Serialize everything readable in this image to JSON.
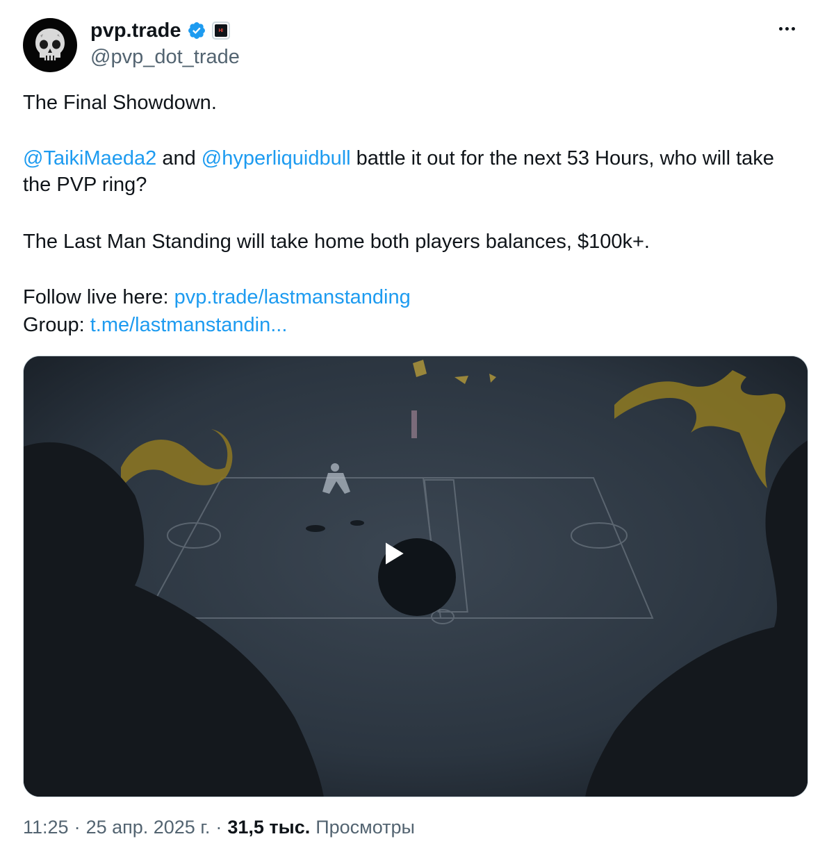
{
  "author": {
    "display_name": "pvp.trade",
    "handle": "@pvp_dot_trade",
    "verified": true,
    "avatar_icon": "skull-icon",
    "affiliation_icon": "affiliate-badge-icon"
  },
  "tweet": {
    "line1": "The Final Showdown.",
    "mention1": "@TaikiMaeda2",
    "and_text": " and ",
    "mention2": "@hyperliquidbull",
    "battle_text": " battle it out for the next 53 Hours, who will take the PVP ring?",
    "line3": "The Last Man Standing will take home both players balances, $100k+.",
    "follow_label": "Follow live here: ",
    "follow_link": "pvp.trade/lastmanstanding",
    "group_label": "Group: ",
    "group_link": "t.me/lastmanstandin..."
  },
  "media": {
    "type": "video",
    "play_icon": "play-icon"
  },
  "footer": {
    "time": "11:25",
    "separator1": "·",
    "date": "25 апр. 2025 г.",
    "separator2": "·",
    "views_count": "31,5 тыс.",
    "views_label": "Просмотры"
  },
  "colors": {
    "link": "#1d9bf0",
    "text": "#0f1419",
    "secondary": "#536471",
    "verified": "#1d9bf0"
  }
}
